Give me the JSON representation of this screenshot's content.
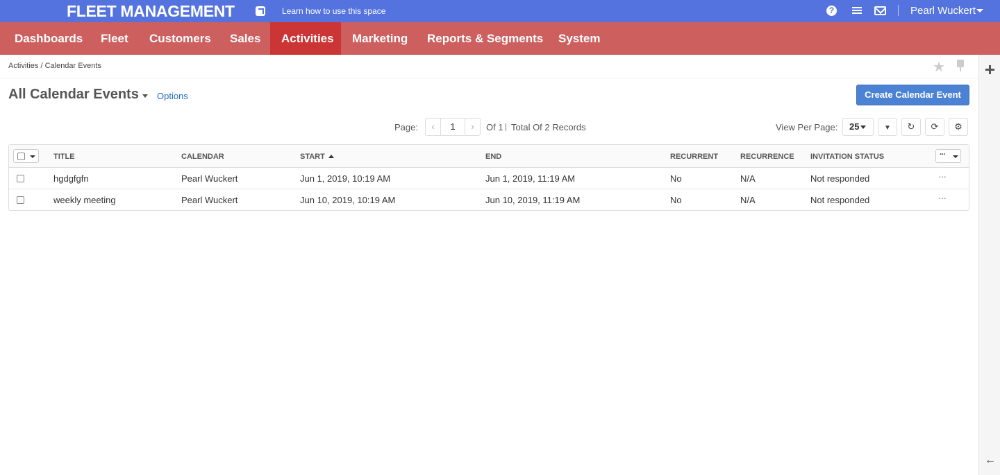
{
  "topbar": {
    "app_title": "FLEET MANAGEMENT",
    "learn_link": "Learn how to use this space",
    "user_name": "Pearl Wuckert",
    "help_glyph": "?"
  },
  "nav": {
    "items": [
      {
        "label": "Dashboards"
      },
      {
        "label": "Fleet"
      },
      {
        "label": "Customers"
      },
      {
        "label": "Sales"
      },
      {
        "label": "Activities",
        "active": true
      },
      {
        "label": "Marketing"
      },
      {
        "label": "Reports & Segments"
      },
      {
        "label": "System"
      }
    ],
    "active_color": "#cc3535",
    "bar_color": "#cd5f5f"
  },
  "breadcrumb": "Activities / Calendar Events",
  "page": {
    "title": "All Calendar Events",
    "options_label": "Options",
    "create_button": "Create Calendar Event"
  },
  "pagination": {
    "page_label": "Page:",
    "current_page": "1",
    "of_pages": "Of 1",
    "total_records": "Total Of 2 Records",
    "view_per_page_label": "View Per Page:",
    "per_page": "25"
  },
  "grid": {
    "columns": [
      "TITLE",
      "CALENDAR",
      "START",
      "END",
      "RECURRENT",
      "RECURRENCE",
      "INVITATION STATUS"
    ],
    "sort_column": "START",
    "rows": [
      {
        "title": "hgdgfgfn",
        "calendar": "Pearl Wuckert",
        "start": "Jun 1, 2019, 10:19 AM",
        "end": "Jun 1, 2019, 11:19 AM",
        "recurrent": "No",
        "recurrence": "N/A",
        "invitation_status": "Not responded",
        "action": "···"
      },
      {
        "title": "weekly meeting",
        "calendar": "Pearl Wuckert",
        "start": "Jun 10, 2019, 10:19 AM",
        "end": "Jun 10, 2019, 11:19 AM",
        "recurrent": "No",
        "recurrence": "N/A",
        "invitation_status": "Not responded",
        "action": "···"
      }
    ],
    "column_menu_glyph": "···"
  },
  "icons": {
    "star": "★",
    "back_arrow": "←",
    "prev": "‹",
    "next": "›",
    "filter": "▼",
    "reset": "↻",
    "refresh": "⟳",
    "settings": "⚙"
  },
  "colors": {
    "topbar": "#5473de",
    "primary_button": "#4c82d4",
    "link": "#1f6fbf"
  }
}
